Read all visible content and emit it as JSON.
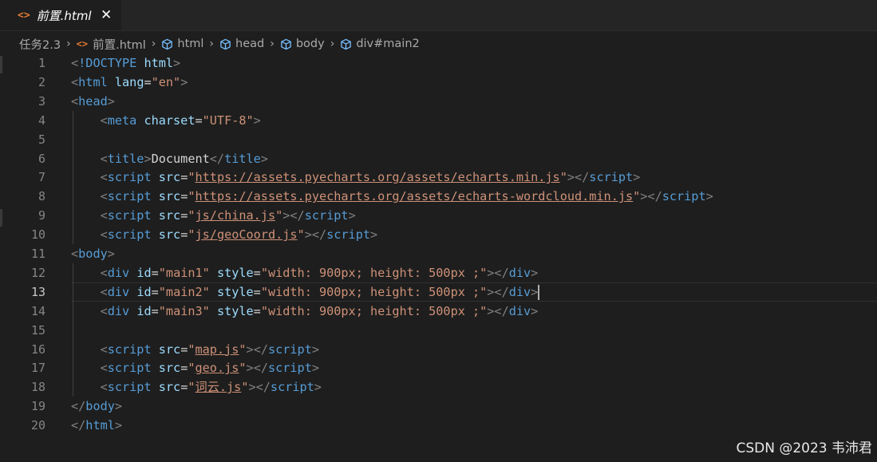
{
  "tab": {
    "icon": "html-file-icon",
    "label": "前置.html",
    "close": "✕"
  },
  "breadcrumb": {
    "folder": "任务2.3",
    "file": "前置.html",
    "items": [
      "html",
      "head",
      "body",
      "div#main2"
    ]
  },
  "editor": {
    "active_line": 13,
    "lines": [
      {
        "n": "1",
        "tokens": [
          [
            "punc",
            "<"
          ],
          [
            "tag",
            "!DOCTYPE"
          ],
          [
            "text",
            " "
          ],
          [
            "attr",
            "html"
          ],
          [
            "punc",
            ">"
          ]
        ]
      },
      {
        "n": "2",
        "tokens": [
          [
            "punc",
            "<"
          ],
          [
            "tag",
            "html"
          ],
          [
            "text",
            " "
          ],
          [
            "attr",
            "lang"
          ],
          [
            "eq",
            "="
          ],
          [
            "str",
            "\"en\""
          ],
          [
            "punc",
            ">"
          ]
        ]
      },
      {
        "n": "3",
        "tokens": [
          [
            "punc",
            "<"
          ],
          [
            "tag",
            "head"
          ],
          [
            "punc",
            ">"
          ]
        ]
      },
      {
        "n": "4",
        "tokens": [
          [
            "text",
            "    "
          ],
          [
            "punc",
            "<"
          ],
          [
            "tag",
            "meta"
          ],
          [
            "text",
            " "
          ],
          [
            "attr",
            "charset"
          ],
          [
            "eq",
            "="
          ],
          [
            "str",
            "\"UTF-8\""
          ],
          [
            "punc",
            ">"
          ]
        ]
      },
      {
        "n": "5",
        "tokens": []
      },
      {
        "n": "6",
        "tokens": [
          [
            "text",
            "    "
          ],
          [
            "punc",
            "<"
          ],
          [
            "tag",
            "title"
          ],
          [
            "punc",
            ">"
          ],
          [
            "text",
            "Document"
          ],
          [
            "punc",
            "</"
          ],
          [
            "tag",
            "title"
          ],
          [
            "punc",
            ">"
          ]
        ]
      },
      {
        "n": "7",
        "tokens": [
          [
            "text",
            "    "
          ],
          [
            "punc",
            "<"
          ],
          [
            "tag",
            "script"
          ],
          [
            "text",
            " "
          ],
          [
            "attr",
            "src"
          ],
          [
            "eq",
            "="
          ],
          [
            "str",
            "\""
          ],
          [
            "link",
            "https://assets.pyecharts.org/assets/echarts.min.js"
          ],
          [
            "str",
            "\""
          ],
          [
            "punc",
            "></"
          ],
          [
            "tag",
            "script"
          ],
          [
            "punc",
            ">"
          ]
        ]
      },
      {
        "n": "8",
        "tokens": [
          [
            "text",
            "    "
          ],
          [
            "punc",
            "<"
          ],
          [
            "tag",
            "script"
          ],
          [
            "text",
            " "
          ],
          [
            "attr",
            "src"
          ],
          [
            "eq",
            "="
          ],
          [
            "str",
            "\""
          ],
          [
            "link",
            "https://assets.pyecharts.org/assets/echarts-wordcloud.min.js"
          ],
          [
            "str",
            "\""
          ],
          [
            "punc",
            "></"
          ],
          [
            "tag",
            "script"
          ],
          [
            "punc",
            ">"
          ]
        ]
      },
      {
        "n": "9",
        "tokens": [
          [
            "text",
            "    "
          ],
          [
            "punc",
            "<"
          ],
          [
            "tag",
            "script"
          ],
          [
            "text",
            " "
          ],
          [
            "attr",
            "src"
          ],
          [
            "eq",
            "="
          ],
          [
            "str",
            "\""
          ],
          [
            "link",
            "js/china.js"
          ],
          [
            "str",
            "\""
          ],
          [
            "punc",
            "></"
          ],
          [
            "tag",
            "script"
          ],
          [
            "punc",
            ">"
          ]
        ]
      },
      {
        "n": "10",
        "tokens": [
          [
            "text",
            "    "
          ],
          [
            "punc",
            "<"
          ],
          [
            "tag",
            "script"
          ],
          [
            "text",
            " "
          ],
          [
            "attr",
            "src"
          ],
          [
            "eq",
            "="
          ],
          [
            "str",
            "\""
          ],
          [
            "link",
            "js/geoCoord.js"
          ],
          [
            "str",
            "\""
          ],
          [
            "punc",
            "></"
          ],
          [
            "tag",
            "script"
          ],
          [
            "punc",
            ">"
          ]
        ]
      },
      {
        "n": "11",
        "tokens": [
          [
            "punc",
            "<"
          ],
          [
            "tag",
            "body"
          ],
          [
            "punc",
            ">"
          ]
        ]
      },
      {
        "n": "12",
        "tokens": [
          [
            "text",
            "    "
          ],
          [
            "punc",
            "<"
          ],
          [
            "tag",
            "div"
          ],
          [
            "text",
            " "
          ],
          [
            "attr",
            "id"
          ],
          [
            "eq",
            "="
          ],
          [
            "str",
            "\"main1\""
          ],
          [
            "text",
            " "
          ],
          [
            "attr",
            "style"
          ],
          [
            "eq",
            "="
          ],
          [
            "str",
            "\"width: 900px; height: 500px ;\""
          ],
          [
            "punc",
            "></"
          ],
          [
            "tag",
            "div"
          ],
          [
            "punc",
            ">"
          ]
        ]
      },
      {
        "n": "13",
        "tokens": [
          [
            "text",
            "    "
          ],
          [
            "punc",
            "<"
          ],
          [
            "tag",
            "div"
          ],
          [
            "text",
            " "
          ],
          [
            "attr",
            "id"
          ],
          [
            "eq",
            "="
          ],
          [
            "str",
            "\"main2\""
          ],
          [
            "text",
            " "
          ],
          [
            "attr",
            "style"
          ],
          [
            "eq",
            "="
          ],
          [
            "str",
            "\"width: 900px; height: 500px ;\""
          ],
          [
            "punc",
            "></"
          ],
          [
            "tag",
            "div"
          ],
          [
            "punc",
            ">"
          ],
          [
            "cursor",
            ""
          ]
        ]
      },
      {
        "n": "14",
        "tokens": [
          [
            "text",
            "    "
          ],
          [
            "punc",
            "<"
          ],
          [
            "tag",
            "div"
          ],
          [
            "text",
            " "
          ],
          [
            "attr",
            "id"
          ],
          [
            "eq",
            "="
          ],
          [
            "str",
            "\"main3\""
          ],
          [
            "text",
            " "
          ],
          [
            "attr",
            "style"
          ],
          [
            "eq",
            "="
          ],
          [
            "str",
            "\"width: 900px; height: 500px ;\""
          ],
          [
            "punc",
            "></"
          ],
          [
            "tag",
            "div"
          ],
          [
            "punc",
            ">"
          ]
        ]
      },
      {
        "n": "15",
        "tokens": []
      },
      {
        "n": "16",
        "tokens": [
          [
            "text",
            "    "
          ],
          [
            "punc",
            "<"
          ],
          [
            "tag",
            "script"
          ],
          [
            "text",
            " "
          ],
          [
            "attr",
            "src"
          ],
          [
            "eq",
            "="
          ],
          [
            "str",
            "\""
          ],
          [
            "link",
            "map.js"
          ],
          [
            "str",
            "\""
          ],
          [
            "punc",
            "></"
          ],
          [
            "tag",
            "script"
          ],
          [
            "punc",
            ">"
          ]
        ]
      },
      {
        "n": "17",
        "tokens": [
          [
            "text",
            "    "
          ],
          [
            "punc",
            "<"
          ],
          [
            "tag",
            "script"
          ],
          [
            "text",
            " "
          ],
          [
            "attr",
            "src"
          ],
          [
            "eq",
            "="
          ],
          [
            "str",
            "\""
          ],
          [
            "link",
            "geo.js"
          ],
          [
            "str",
            "\""
          ],
          [
            "punc",
            "></"
          ],
          [
            "tag",
            "script"
          ],
          [
            "punc",
            ">"
          ]
        ]
      },
      {
        "n": "18",
        "tokens": [
          [
            "text",
            "    "
          ],
          [
            "punc",
            "<"
          ],
          [
            "tag",
            "script"
          ],
          [
            "text",
            " "
          ],
          [
            "attr",
            "src"
          ],
          [
            "eq",
            "="
          ],
          [
            "str",
            "\""
          ],
          [
            "link",
            "词云.js"
          ],
          [
            "str",
            "\""
          ],
          [
            "punc",
            "></"
          ],
          [
            "tag",
            "script"
          ],
          [
            "punc",
            ">"
          ]
        ]
      },
      {
        "n": "19",
        "tokens": [
          [
            "punc",
            "</"
          ],
          [
            "tag",
            "body"
          ],
          [
            "punc",
            ">"
          ]
        ]
      },
      {
        "n": "20",
        "tokens": [
          [
            "punc",
            "</"
          ],
          [
            "tag",
            "html"
          ],
          [
            "punc",
            ">"
          ]
        ]
      }
    ]
  },
  "watermark": "CSDN @2023 韦沛君",
  "colors": {
    "background": "#1e1e1e",
    "tag": "#569cd6",
    "attribute": "#9cdcfe",
    "string": "#ce9178",
    "punctuation": "#808080",
    "html_icon": "#e37933"
  }
}
